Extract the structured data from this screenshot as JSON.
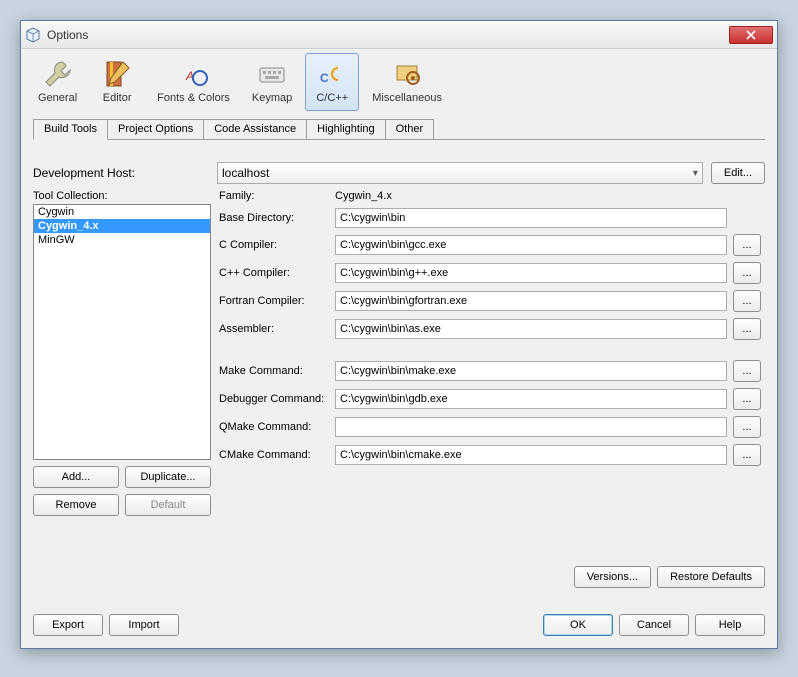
{
  "window": {
    "title": "Options"
  },
  "toolbar": {
    "items": [
      {
        "label": "General"
      },
      {
        "label": "Editor"
      },
      {
        "label": "Fonts & Colors"
      },
      {
        "label": "Keymap"
      },
      {
        "label": "C/C++"
      },
      {
        "label": "Miscellaneous"
      }
    ]
  },
  "subtabs": [
    "Build Tools",
    "Project Options",
    "Code Assistance",
    "Highlighting",
    "Other"
  ],
  "devhost": {
    "label": "Development Host:",
    "value": "localhost",
    "edit": "Edit..."
  },
  "toolcoll": {
    "label": "Tool Collection:",
    "items": [
      "Cygwin",
      "Cygwin_4.x",
      "MinGW"
    ],
    "buttons": {
      "add": "Add...",
      "duplicate": "Duplicate...",
      "remove": "Remove",
      "default": "Default"
    }
  },
  "form": {
    "family_label": "Family:",
    "family_value": "Cygwin_4.x",
    "basedir_label": "Base Directory:",
    "basedir_value": "C:\\cygwin\\bin",
    "ccomp_label": "C Compiler:",
    "ccomp_value": "C:\\cygwin\\bin\\gcc.exe",
    "cpp_label": "C++ Compiler:",
    "cpp_value": "C:\\cygwin\\bin\\g++.exe",
    "fortran_label": "Fortran Compiler:",
    "fortran_value": "C:\\cygwin\\bin\\gfortran.exe",
    "asm_label": "Assembler:",
    "asm_value": "C:\\cygwin\\bin\\as.exe",
    "make_label": "Make Command:",
    "make_value": "C:\\cygwin\\bin\\make.exe",
    "dbg_label": "Debugger Command:",
    "dbg_value": "C:\\cygwin\\bin\\gdb.exe",
    "qmake_label": "QMake Command:",
    "qmake_value": "",
    "cmake_label": "CMake Command:",
    "cmake_value": "C:\\cygwin\\bin\\cmake.exe"
  },
  "dots": "...",
  "bottom": {
    "versions": "Versions...",
    "restore": "Restore Defaults"
  },
  "footer": {
    "export": "Export",
    "import": "Import",
    "ok": "OK",
    "cancel": "Cancel",
    "help": "Help"
  }
}
